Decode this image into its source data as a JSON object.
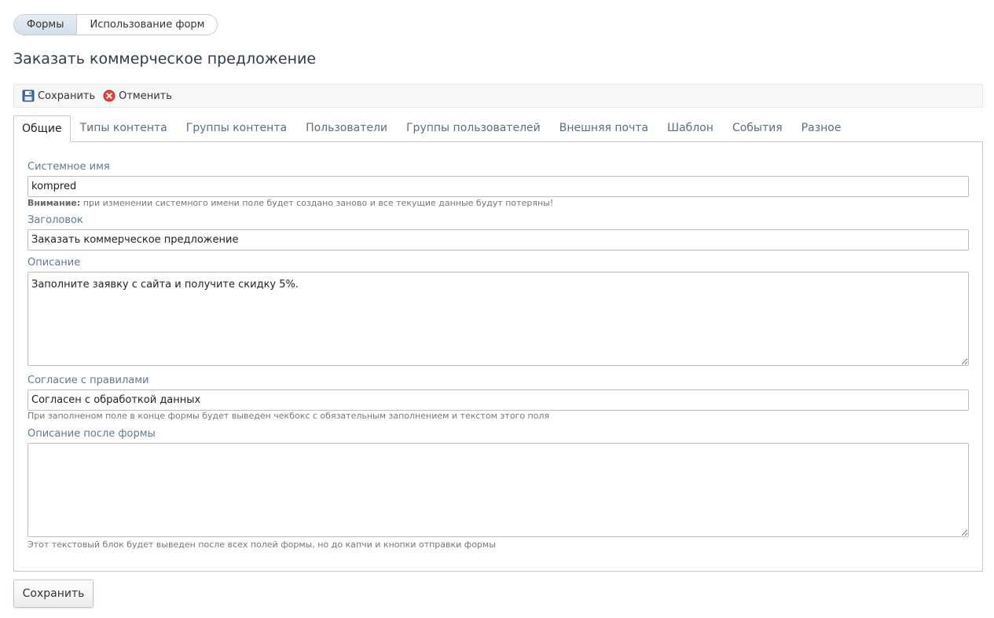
{
  "top_nav": {
    "forms": "Формы",
    "forms_usage": "Использование форм"
  },
  "page": {
    "title": "Заказать коммерческое предложение"
  },
  "toolbar": {
    "save_label": "Сохранить",
    "cancel_label": "Отменить",
    "save_icon": "floppy-disk-icon",
    "cancel_icon": "cancel-circle-icon"
  },
  "tabs": [
    {
      "label": "Общие",
      "active": true
    },
    {
      "label": "Типы контента"
    },
    {
      "label": "Группы контента"
    },
    {
      "label": "Пользователи"
    },
    {
      "label": "Группы пользователей"
    },
    {
      "label": "Внешняя почта"
    },
    {
      "label": "Шаблон"
    },
    {
      "label": "События"
    },
    {
      "label": "Разное"
    }
  ],
  "fields": {
    "system_name": {
      "label": "Системное имя",
      "value": "kompred",
      "warning_bold": "Внимание:",
      "warning_text": " при изменении системного имени поле будет создано заново и все текущие данные будут потеряны!"
    },
    "title": {
      "label": "Заголовок",
      "value": "Заказать коммерческое предложение"
    },
    "description": {
      "label": "Описание",
      "value": "Заполните заявку с сайта и получите скидку 5%."
    },
    "agreement": {
      "label": "Согласие с правилами",
      "value": "Согласен с обработкой данных",
      "hint": "При заполненом поле в конце формы будет выведен чекбокс с обязательным заполнением и текстом этого поля"
    },
    "after_description": {
      "label": "Описание после формы",
      "value": "",
      "hint": "Этот текстовый блок будет выведен после всех полей формы, но до капчи и кнопки отправки формы"
    }
  },
  "footer": {
    "save_label": "Сохранить"
  },
  "colors": {
    "label": "#5c7a99",
    "tab_text": "#5a6e84",
    "title": "#2d3b4a"
  }
}
